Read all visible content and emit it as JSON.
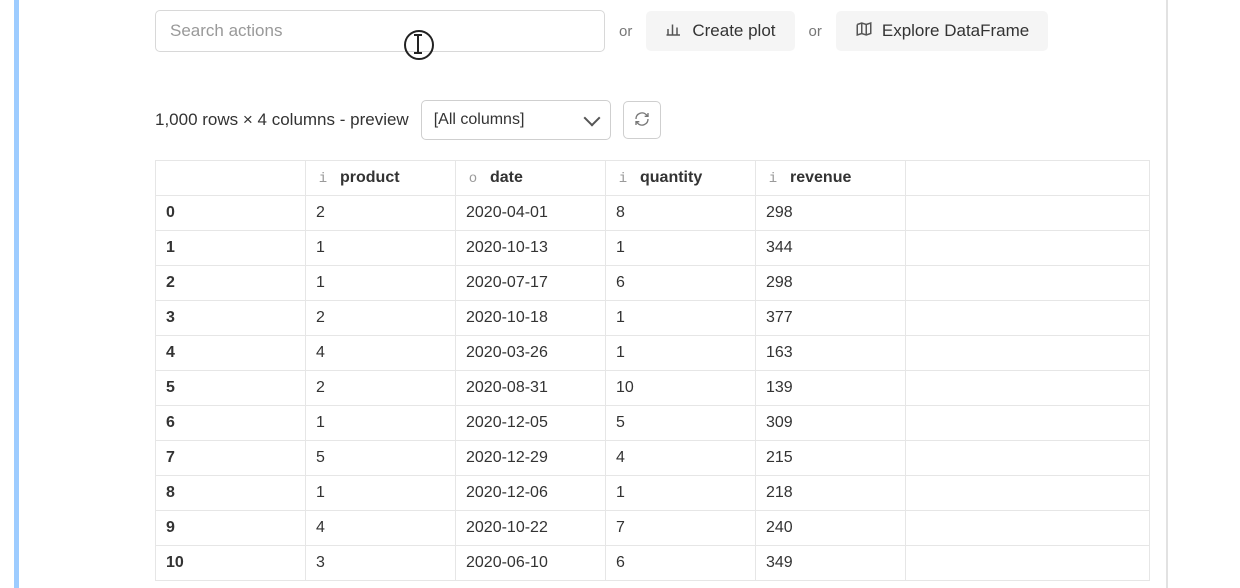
{
  "toolbar": {
    "search_placeholder": "Search actions",
    "or_label": "or",
    "create_plot_label": "Create plot",
    "explore_df_label": "Explore DataFrame"
  },
  "meta": {
    "summary": "1,000 rows × 4 columns - preview",
    "columns_selector": "[All columns]"
  },
  "columns": [
    {
      "dtype": "i",
      "name": "product"
    },
    {
      "dtype": "o",
      "name": "date"
    },
    {
      "dtype": "i",
      "name": "quantity"
    },
    {
      "dtype": "i",
      "name": "revenue"
    }
  ],
  "rows": [
    {
      "idx": "0",
      "product": "2",
      "date": "2020-04-01",
      "quantity": "8",
      "revenue": "298"
    },
    {
      "idx": "1",
      "product": "1",
      "date": "2020-10-13",
      "quantity": "1",
      "revenue": "344"
    },
    {
      "idx": "2",
      "product": "1",
      "date": "2020-07-17",
      "quantity": "6",
      "revenue": "298"
    },
    {
      "idx": "3",
      "product": "2",
      "date": "2020-10-18",
      "quantity": "1",
      "revenue": "377"
    },
    {
      "idx": "4",
      "product": "4",
      "date": "2020-03-26",
      "quantity": "1",
      "revenue": "163"
    },
    {
      "idx": "5",
      "product": "2",
      "date": "2020-08-31",
      "quantity": "10",
      "revenue": "139"
    },
    {
      "idx": "6",
      "product": "1",
      "date": "2020-12-05",
      "quantity": "5",
      "revenue": "309"
    },
    {
      "idx": "7",
      "product": "5",
      "date": "2020-12-29",
      "quantity": "4",
      "revenue": "215"
    },
    {
      "idx": "8",
      "product": "1",
      "date": "2020-12-06",
      "quantity": "1",
      "revenue": "218"
    },
    {
      "idx": "9",
      "product": "4",
      "date": "2020-10-22",
      "quantity": "7",
      "revenue": "240"
    },
    {
      "idx": "10",
      "product": "3",
      "date": "2020-06-10",
      "quantity": "6",
      "revenue": "349"
    }
  ]
}
